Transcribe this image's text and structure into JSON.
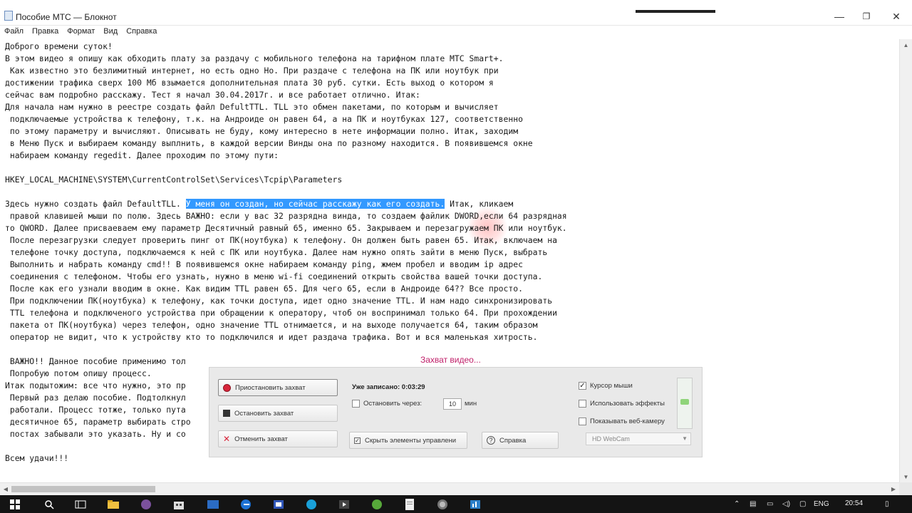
{
  "window": {
    "title": "Пособие МТС — Блокнот",
    "controls": {
      "minimize": "—",
      "maximize": "❐",
      "close": "✕"
    }
  },
  "menu": [
    "Файл",
    "Правка",
    "Формат",
    "Вид",
    "Справка"
  ],
  "document": {
    "lines": [
      "Доброго времени суток!",
      "В этом видео я опишу как обходить плату за раздачу с мобильного телефона на тарифном плате МТС Smart+.",
      " Как известно это безлимитный интернет, но есть одно Но. При раздаче с телефона на ПК или ноутбук при",
      "достижении трафика сверх 100 Мб взымается дополнительная плата 30 руб. сутки. Есть выход о котором я",
      "сейчас вам подробно расскажу. Тест я начал 30.04.2017г. и все работает отлично. Итак:",
      "Для начала нам нужно в реестре создать файл DefultTTL. TLL это обмен пакетами, по которым и вычисляет",
      " подключаемые устройства к телефону, т.к. на Андроиде он равен 64, а на ПК и ноутбуках 127, соответственно",
      " по этому параметру и вычисляют. Описывать не буду, кому интересно в нете информации полно. Итак, заходим",
      " в Меню Пуск и выбираем команду выплнить, в каждой версии Винды она по разному находится. В появившемся окне",
      " набираем команду regedit. Далее проходим по этому пути:",
      "",
      "HKEY_LOCAL_MACHINE\\SYSTEM\\CurrentControlSet\\Services\\Tcpip\\Parameters",
      "",
      "Здесь нужно создать файл DefaultTLL. ",
      " правой клавишей мыши по полю. Здесь ВАЖНО: если у вас 32 разрядна винда, то создаем файлик DWORD,если 64 разрядная",
      "то QWORD. Далее присваеваем ему параметр Десятичный равный 65, именно 65. Закрываем и перезагружаем ПК или ноутбук.",
      " После перезагрузки следует проверить пинг от ПК(ноутбука) к телефону. Он должен быть равен 65. Итак, включаем на",
      " телефоне точку доступа, подключаемся к ней с ПК или ноутбука. Далее нам нужно опять зайти в меню Пуск, выбрать",
      " Выполнить и набрать команду cmd!! В появившемся окне набираем команду ping, жмем пробел и вводим ip адрес",
      " соединения с телефоном. Чтобы его узнать, нужно в меню wi-fi соединений открыть свойства вашей точки доступа.",
      " После как его узнали вводим в окне. Как видим TTL равен 65. Для чего 65, если в Андроиде 64?? Все просто.",
      " При подключении ПК(ноутбука) к телефону, как точки доступа, идет одно значение TTL. И нам надо синхронизировать",
      " TTL телефона и подключеного устройства при обращении к оператору, чтоб он воспринимал только 64. При прохождении",
      " пакета от ПК(ноутбука) через телефон, одно значение TTL отнимается, и на выходе получается 64, таким образом",
      " оператор не видит, что к устройству кто то подключился и идет раздача трафика. Вот и вся маленькая хитрость.",
      "",
      " ВАЖНО!! Данное пособие применимо тол",
      " Попробую потом опишу процесс.",
      "Итак подытожим: все что нужно, это пр",
      " Первый раз делаю пособие. Подтолкнул",
      " работали. Процесс тотже, только пута",
      " десятичное 65, параметр выбирать стро",
      " постах забывали это указать. Ну и со",
      "",
      "Всем удачи!!!"
    ],
    "selected_text": "У меня он создан, но сейчас расскажу как его создать.",
    "after_selection": " Итак, кликаем"
  },
  "capture_panel": {
    "title": "Захват видео...",
    "buttons": {
      "pause": "Приостановить захват",
      "stop": "Остановить захват",
      "cancel": "Отменить захват",
      "hide_controls": "Скрыть элементы управлени",
      "help": "Справка"
    },
    "recorded_label": "Уже записано: 0:03:29",
    "stop_after_label": "Остановить через:",
    "stop_after_value": "10",
    "stop_after_unit": "мин",
    "options": [
      {
        "label": "Курсор мыши",
        "checked": true
      },
      {
        "label": "Использовать эффекты",
        "checked": false
      },
      {
        "label": "Показывать веб-камеру",
        "checked": false
      }
    ],
    "webcam_select": "HD WebCam"
  },
  "taskbar": {
    "lang": "ENG",
    "time": "20:54"
  }
}
